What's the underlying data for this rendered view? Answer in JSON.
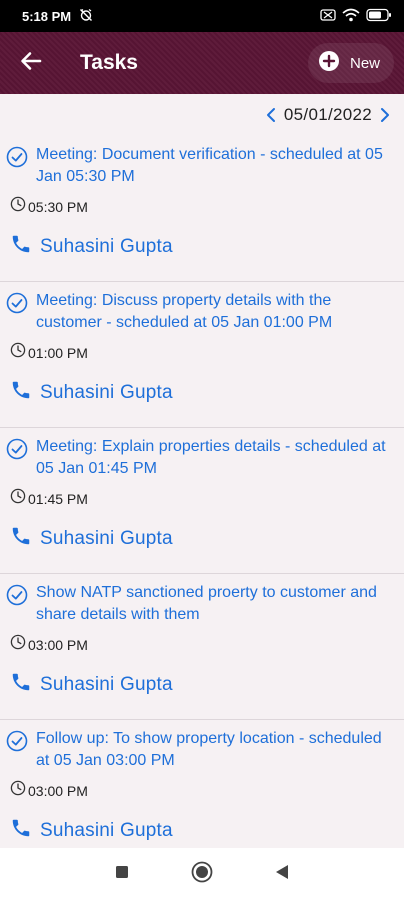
{
  "status_bar": {
    "time": "5:18 PM",
    "icons": [
      "alarm-off-icon",
      "sim-card-icon",
      "wifi-icon",
      "battery-icon"
    ],
    "battery": "55"
  },
  "app_bar": {
    "title": "Tasks",
    "new_label": "New",
    "back_icon": "arrow-left-icon",
    "new_icon": "plus-circle-icon"
  },
  "date_nav": {
    "date": "05/01/2022"
  },
  "tasks": [
    {
      "title": "Meeting: Document verification - scheduled at 05 Jan 05:30 PM",
      "time": "05:30 PM",
      "contact": "Suhasini Gupta"
    },
    {
      "title": "Meeting: Discuss property details with the customer - scheduled at 05 Jan 01:00 PM",
      "time": "01:00 PM",
      "contact": "Suhasini Gupta"
    },
    {
      "title": "Meeting: Explain properties details - scheduled at 05 Jan 01:45 PM",
      "time": "01:45 PM",
      "contact": "Suhasini Gupta"
    },
    {
      "title": "Show NATP sanctioned proerty to customer and share details with them",
      "time": "03:00 PM",
      "contact": "Suhasini Gupta"
    },
    {
      "title": "Follow up: To show property location - scheduled at 05 Jan 03:00 PM",
      "time": "03:00 PM",
      "contact": "Suhasini Gupta"
    }
  ],
  "colors": {
    "app_bar": "#5a1535",
    "accent": "#1e6fd9",
    "background": "#f6f1f3"
  }
}
